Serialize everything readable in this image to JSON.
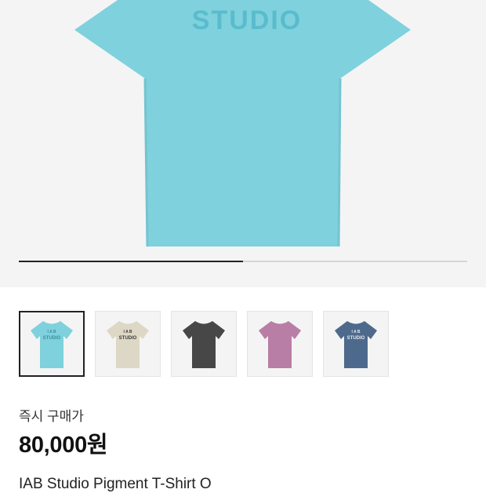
{
  "hero": {
    "shirt_text": "STUDIO",
    "shirt_color": "#7fd1dd",
    "shirt_print_color": "#59bccd",
    "slide_progress": 0.5
  },
  "thumbnails": [
    {
      "color": "#7fd1dd",
      "print": "#3a8fa0",
      "has_print": true,
      "selected": true
    },
    {
      "color": "#ddd8c5",
      "print": "#3a3a3a",
      "has_print": true,
      "selected": false
    },
    {
      "color": "#474747",
      "print": "#555555",
      "has_print": false,
      "selected": false
    },
    {
      "color": "#b97ea6",
      "print": "#a96a96",
      "has_print": false,
      "selected": false
    },
    {
      "color": "#4d6a8c",
      "print": "#e8e8e8",
      "has_print": true,
      "selected": false
    }
  ],
  "thumb_print_text": "STUDIO",
  "thumb_logo_text": "I A B",
  "price": {
    "label": "즉시 구매가",
    "amount": "80,000원"
  },
  "product": {
    "name": "IAB Studio Pigment T-Shirt O"
  }
}
